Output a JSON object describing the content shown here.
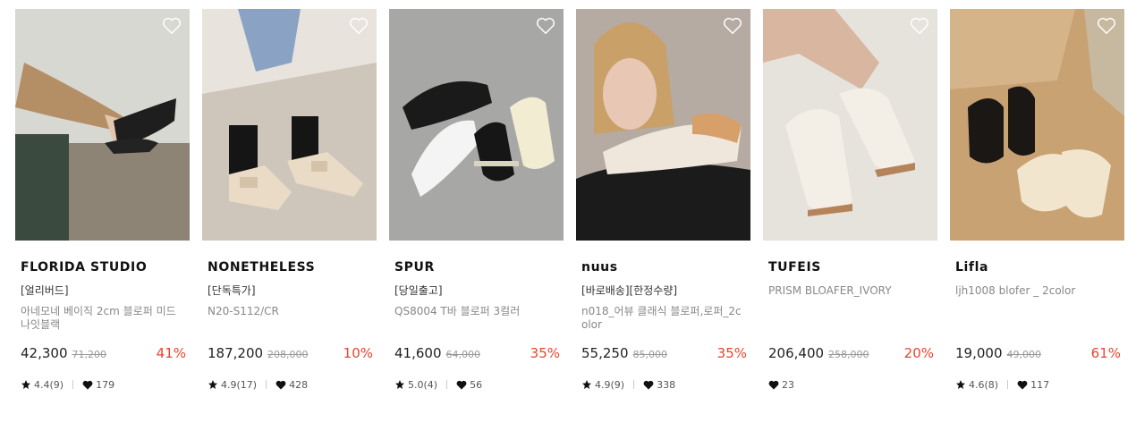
{
  "products": [
    {
      "brand": "FLORIDA STUDIO",
      "tag": "[얼리버드]",
      "name": "아네모네 베이직 2cm 블로퍼 미드나잇블랙",
      "price": "42,300",
      "original_price": "71,200",
      "discount": "41%",
      "rating": "4.4(9)",
      "likes": "179",
      "has_rating": true
    },
    {
      "brand": "NONETHELESS",
      "tag": "[단독특가]",
      "name": "N20-S112/CR",
      "price": "187,200",
      "original_price": "208,000",
      "discount": "10%",
      "rating": "4.9(17)",
      "likes": "428",
      "has_rating": true
    },
    {
      "brand": "SPUR",
      "tag": "[당일출고]",
      "name": "QS8004 T바 블로퍼 3컬러",
      "price": "41,600",
      "original_price": "64,000",
      "discount": "35%",
      "rating": "5.0(4)",
      "likes": "56",
      "has_rating": true
    },
    {
      "brand": "nuus",
      "tag": "[바로배송][한정수량]",
      "name": "n018_어뷰 클래식 블로퍼,로퍼_2color",
      "price": "55,250",
      "original_price": "85,000",
      "discount": "35%",
      "rating": "4.9(9)",
      "likes": "338",
      "has_rating": true
    },
    {
      "brand": "TUFEIS",
      "tag": "",
      "name": "PRISM BLOAFER_IVORY",
      "price": "206,400",
      "original_price": "258,000",
      "discount": "20%",
      "rating": "",
      "likes": "23",
      "has_rating": false
    },
    {
      "brand": "Lifla",
      "tag": "",
      "name": "ljh1008 blofer _ 2color",
      "price": "19,000",
      "original_price": "49,000",
      "discount": "61%",
      "rating": "4.6(8)",
      "likes": "117",
      "has_rating": true
    }
  ],
  "icons": {
    "wishlist": "heart-outline-icon",
    "rating": "star-icon",
    "likes": "heart-filled-icon"
  },
  "colors": {
    "discount": "#e8452c",
    "strike_price": "#999999",
    "brand": "#111111"
  }
}
